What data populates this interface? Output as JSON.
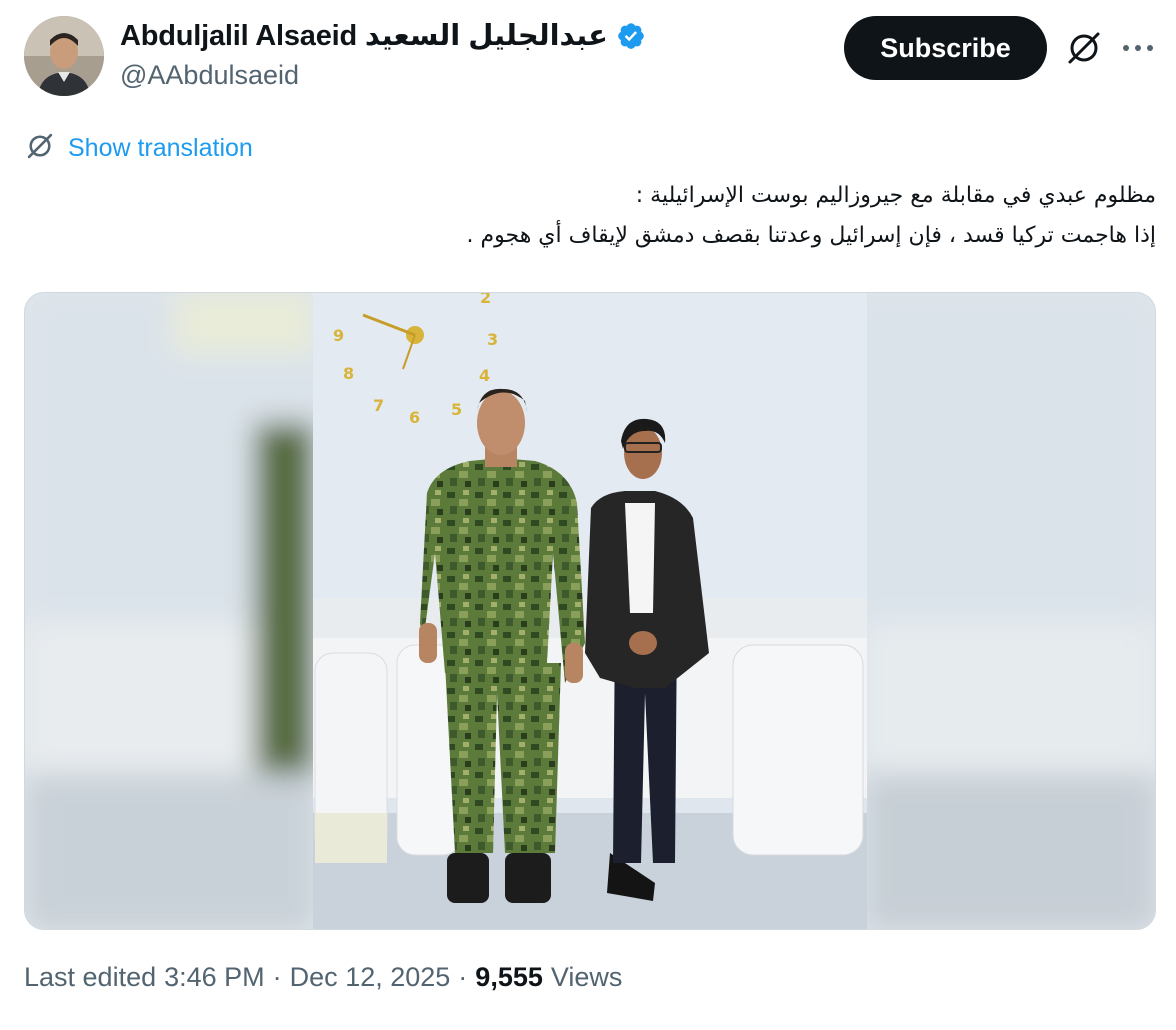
{
  "author": {
    "display_name": "Abduljalil Alsaeid عبدالجليل السعيد",
    "handle": "@AAbdulsaeid",
    "verified": true
  },
  "actions": {
    "subscribe_label": "Subscribe"
  },
  "translate": {
    "label": "Show translation"
  },
  "tweet": {
    "line1": "مظلوم عبدي في مقابلة مع جيروزاليم بوست الإسرائيلية :",
    "line2": "إذا هاجمت تركيا قسد ، فإن إسرائيل وعدتنا بقصف دمشق لإيقاف أي هجوم ."
  },
  "meta": {
    "edited_label": "Last edited",
    "time": "3:46 PM",
    "separator": "·",
    "date": "Dec 12, 2025",
    "views_count": "9,555",
    "views_label": "Views"
  },
  "colors": {
    "accent": "#1d9bf0",
    "text_primary": "#0f1419",
    "text_secondary": "#536471",
    "button_bg": "#0f1419"
  },
  "icons": {
    "verified": "verified-badge-icon",
    "grok": "grok-icon",
    "more": "more-icon",
    "translate": "translate-icon"
  }
}
